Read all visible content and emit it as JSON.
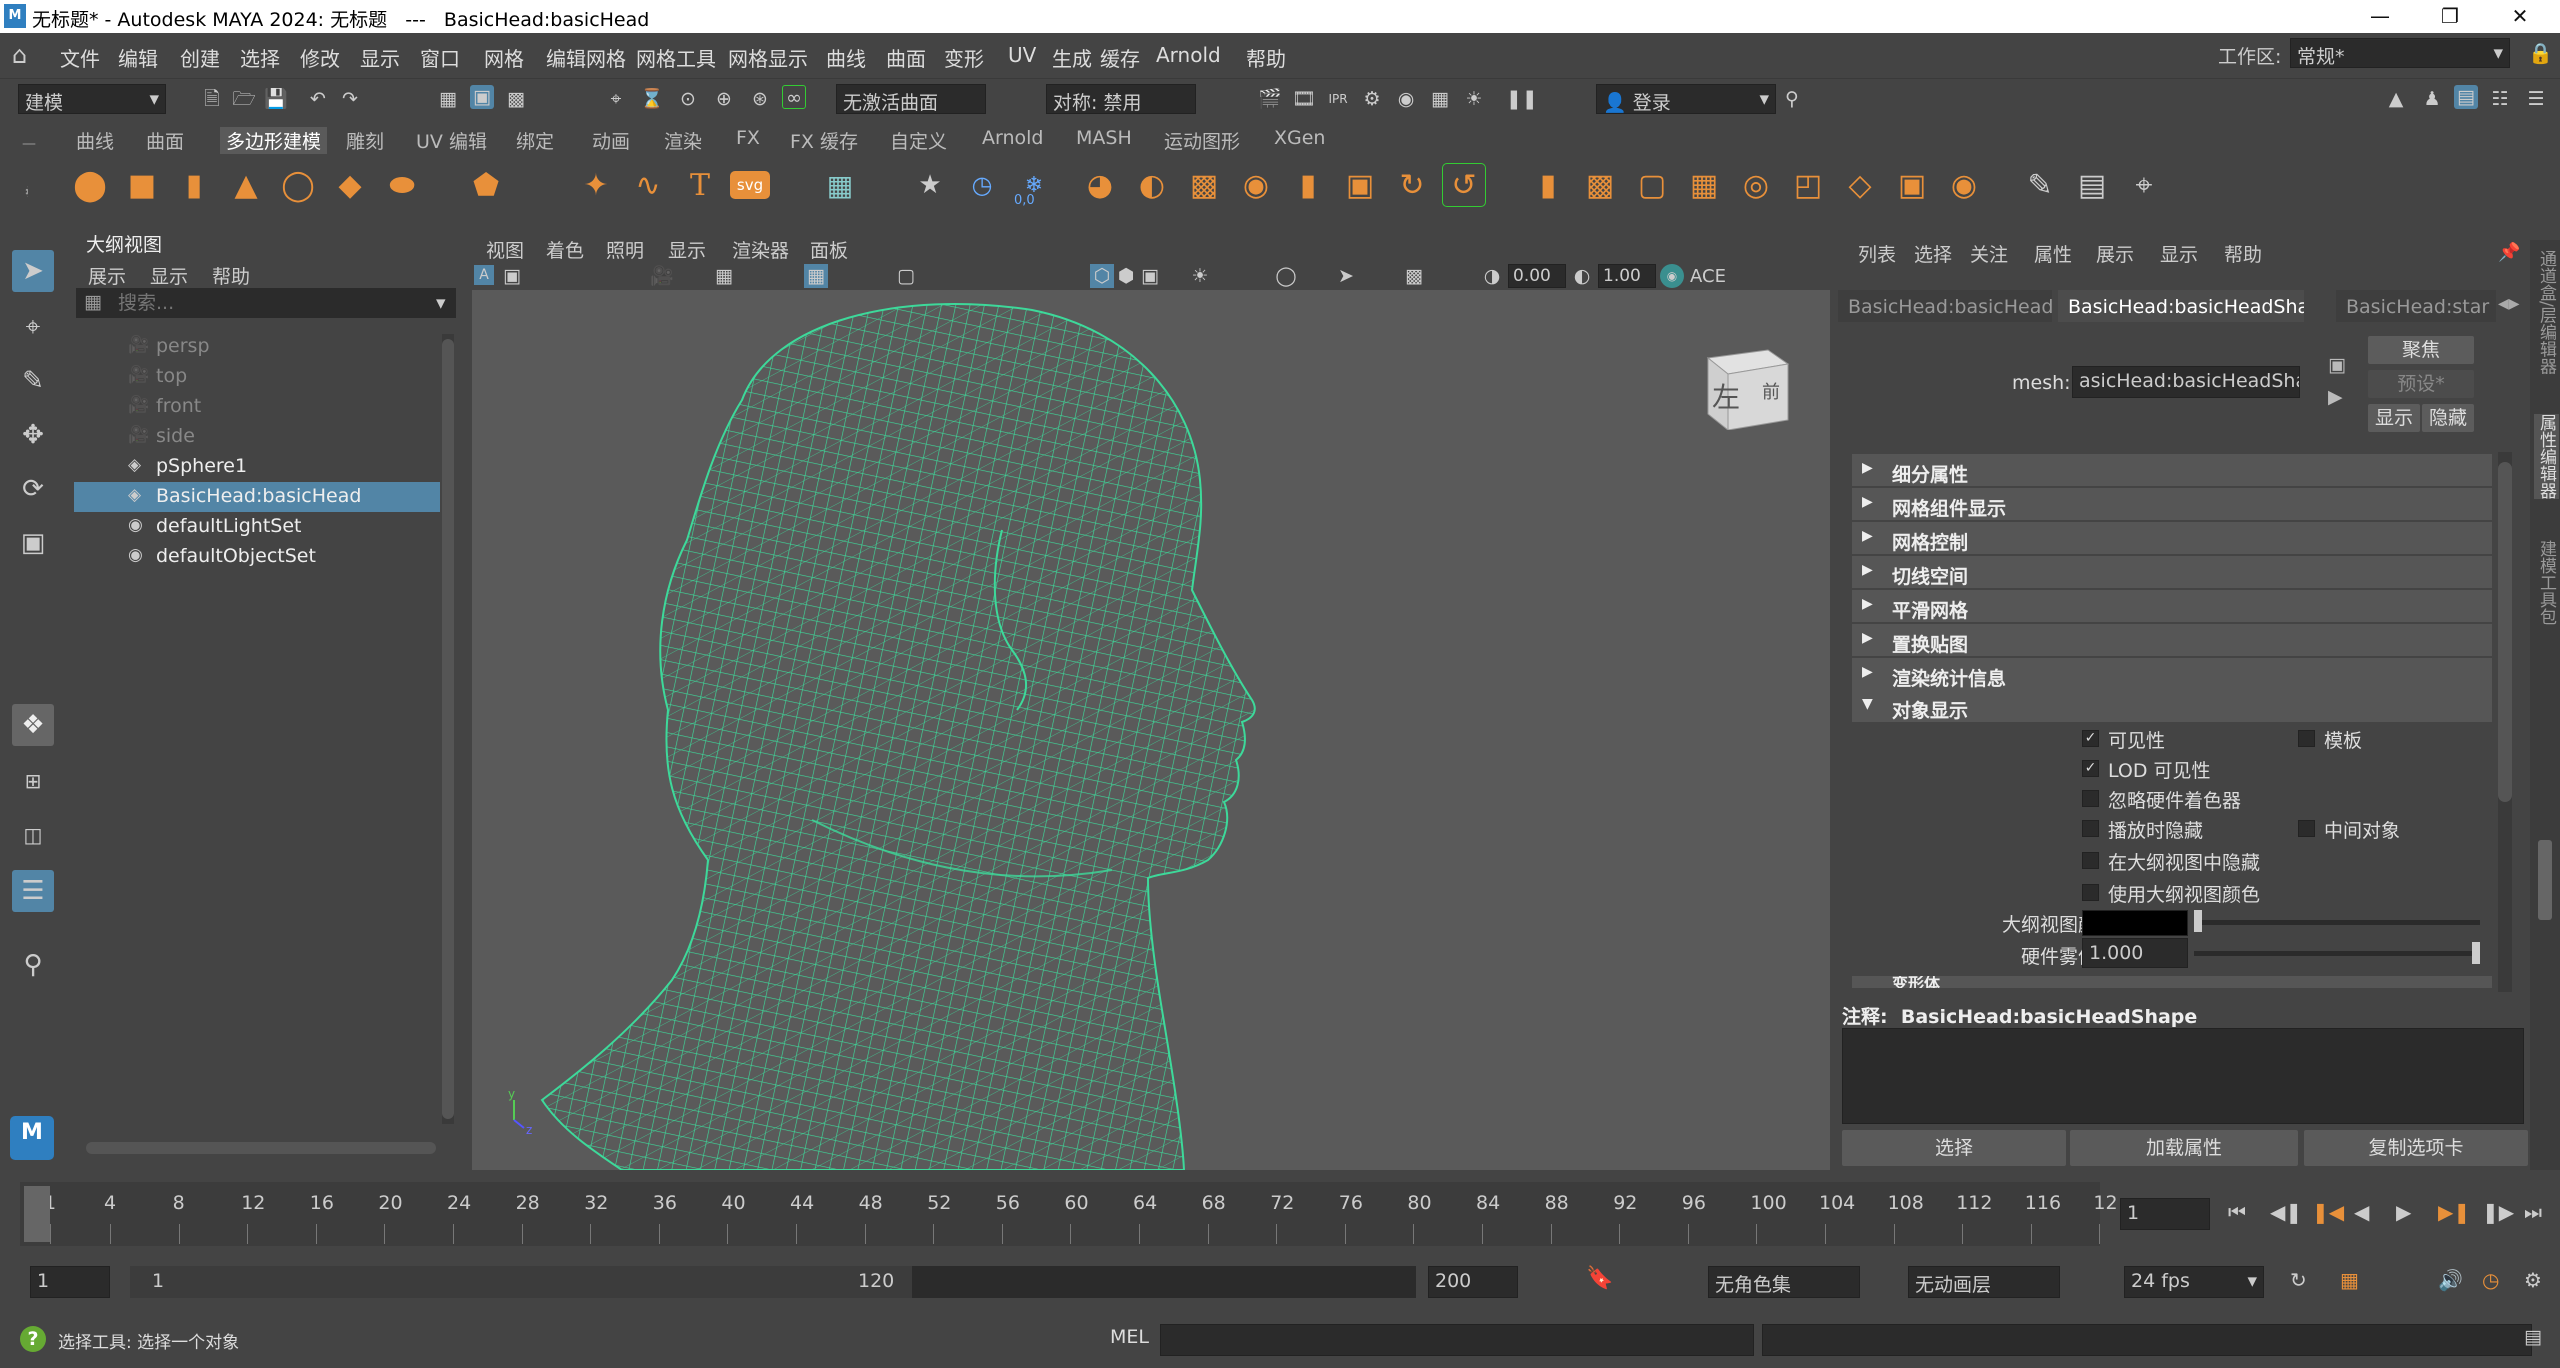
{
  "window": {
    "title": "无标题* - Autodesk MAYA 2024: 无标题   ---   BasicHead:basicHead",
    "logo": "M"
  },
  "menubar": {
    "items": [
      "文件",
      "编辑",
      "创建",
      "选择",
      "修改",
      "显示",
      "窗口",
      "网格",
      "编辑网格",
      "网格工具",
      "网格显示",
      "曲线",
      "曲面",
      "变形",
      "UV",
      "生成",
      "缓存",
      "Arnold",
      "帮助"
    ],
    "workspace_label": "工作区:",
    "workspace_value": "常规*"
  },
  "statusline": {
    "mode": "建模",
    "live_surface": "无激活曲面",
    "symmetry": "对称: 禁用",
    "login": "登录"
  },
  "shelf": {
    "tabs": [
      "曲线",
      "曲面",
      "多边形建模",
      "雕刻",
      "UV 编辑",
      "绑定",
      "动画",
      "渲染",
      "FX",
      "FX 缓存",
      "自定义",
      "Arnold",
      "MASH",
      "运动图形",
      "XGen"
    ],
    "active_tab": "多边形建模",
    "svg_label": "svg",
    "value_readout": "0,0"
  },
  "outliner": {
    "title": "大纲视图",
    "menu": [
      "展示",
      "显示",
      "帮助"
    ],
    "search_placeholder": "搜索...",
    "items": [
      {
        "label": "persp",
        "icon": "camera-icon",
        "dim": true
      },
      {
        "label": "top",
        "icon": "camera-icon",
        "dim": true
      },
      {
        "label": "front",
        "icon": "camera-icon",
        "dim": true
      },
      {
        "label": "side",
        "icon": "camera-icon",
        "dim": true
      },
      {
        "label": "pSphere1",
        "icon": "mesh-icon",
        "dim": false
      },
      {
        "label": "BasicHead:basicHead",
        "icon": "mesh-icon",
        "dim": false,
        "selected": true
      },
      {
        "label": "defaultLightSet",
        "icon": "set-icon",
        "dim": false
      },
      {
        "label": "defaultObjectSet",
        "icon": "set-icon",
        "dim": false
      }
    ]
  },
  "viewport": {
    "menu": [
      "视图",
      "着色",
      "照明",
      "显示",
      "渲染器",
      "面板"
    ],
    "value1": "0.00",
    "value2": "1.00",
    "ace": "ACE",
    "viewcube_left": "左",
    "viewcube_front": "前",
    "axis_y": "y",
    "axis_z": "z"
  },
  "attr": {
    "menu": [
      "列表",
      "选择",
      "关注",
      "属性",
      "展示",
      "显示",
      "帮助"
    ],
    "tabs": [
      "BasicHead:basicHead",
      "BasicHead:basicHeadShape",
      "BasicHead:star"
    ],
    "active_tab": "BasicHead:basicHeadShape",
    "mesh_label": "mesh:",
    "mesh_value": "asicHead:basicHeadShape",
    "focus": "聚焦",
    "preset": "预设*",
    "show": "显示",
    "hide": "隐藏",
    "sections": [
      "细分属性",
      "网格组件显示",
      "网格控制",
      "切线空间",
      "平滑网格",
      "置换贴图",
      "渲染统计信息"
    ],
    "open_section": "对象显示",
    "checks": [
      {
        "label": "可见性",
        "checked": true
      },
      {
        "label": "模板",
        "checked": false
      },
      {
        "label": "LOD 可见性",
        "checked": true
      },
      {
        "label": "忽略硬件着色器",
        "checked": false
      },
      {
        "label": "播放时隐藏",
        "checked": false
      },
      {
        "label": "中间对象",
        "checked": false
      },
      {
        "label": "在大纲视图中隐藏",
        "checked": false
      },
      {
        "label": "使用大纲视图颜色",
        "checked": false
      }
    ],
    "outliner_color_label": "大纲视图颜色",
    "fog_label": "硬件雾倍增",
    "fog_value": "1.000",
    "next_section": "变形体",
    "notes_label": "注释:",
    "notes_value": "BasicHead:basicHeadShape",
    "buttons": [
      "选择",
      "加载属性",
      "复制选项卡"
    ]
  },
  "timeline": {
    "ticks": [
      "1",
      "4",
      "8",
      "12",
      "16",
      "20",
      "24",
      "28",
      "32",
      "36",
      "40",
      "44",
      "48",
      "52",
      "56",
      "60",
      "64",
      "68",
      "72",
      "76",
      "80",
      "84",
      "88",
      "92",
      "96",
      "100",
      "104",
      "108",
      "112",
      "116",
      "12"
    ],
    "current_frame": "1"
  },
  "range": {
    "start": "1",
    "range_start": "1",
    "range_end": "120",
    "end": "200",
    "char_set": "无角色集",
    "anim_layer": "无动画层",
    "fps": "24 fps"
  },
  "cmdline": {
    "help": "选择工具: 选择一个对象",
    "lang": "MEL"
  },
  "side_tabs": [
    "通道盒/层编辑器",
    "属性编辑器",
    "建模工具包"
  ],
  "colors": {
    "accent": "#5285a6",
    "wire": "#3dd99a",
    "shelf_orange": "#e8903a"
  }
}
